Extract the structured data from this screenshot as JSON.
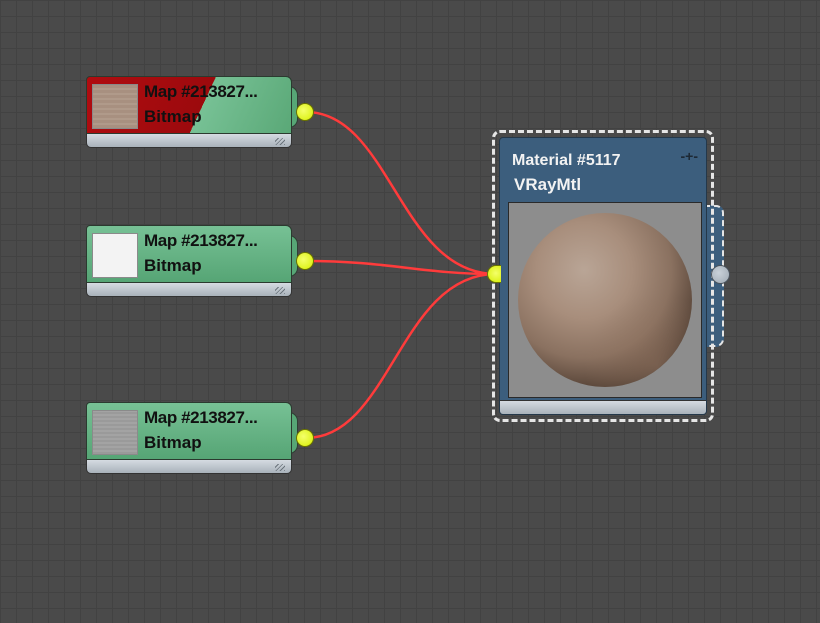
{
  "map_nodes": [
    {
      "title": "Map #213827...",
      "type": "Bitmap",
      "state": "error",
      "thumb_color": "#a89080"
    },
    {
      "title": "Map #213827...",
      "type": "Bitmap",
      "state": "normal",
      "thumb_color": "#f2f2f2"
    },
    {
      "title": "Map #213827...",
      "type": "Bitmap",
      "state": "normal",
      "thumb_color": "#9a9a9a"
    }
  ],
  "material_node": {
    "title": "Material #5117",
    "type": "VRayMtl",
    "pin_glyph": "-+-"
  },
  "colors": {
    "canvas_bg": "#4a4a4a",
    "map_node": "#63b07f",
    "map_node_error": "#b00c10",
    "material_node": "#3c5e7d",
    "socket_output": "#d6ee00",
    "wire": "#ff3b3b"
  },
  "icons": {
    "output_socket": "yellow-circle",
    "material_output_socket": "grey-circle",
    "resize_grip": "diagonal-lines",
    "pin": "plus-minus-glyph"
  }
}
